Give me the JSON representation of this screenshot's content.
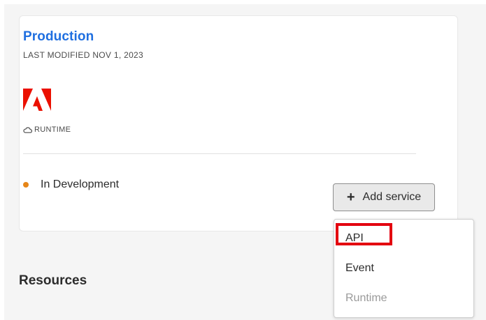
{
  "card": {
    "title": "Production",
    "last_modified": "LAST MODIFIED NOV 1, 2023",
    "logo_icon": "adobe-logo",
    "runtime_label": "RUNTIME",
    "runtime_icon": "cloud-icon",
    "status_text": "In Development",
    "status_color": "#e68619",
    "add_service_label": "Add service",
    "add_service_icon": "plus-icon"
  },
  "menu": {
    "items": [
      {
        "label": "API",
        "enabled": true,
        "highlighted": true
      },
      {
        "label": "Event",
        "enabled": true
      },
      {
        "label": "Runtime",
        "enabled": false
      }
    ]
  },
  "resources_heading": "Resources",
  "colors": {
    "title_blue": "#1f6fe0",
    "adobe_red": "#eb1000",
    "highlight_red": "#e3000f",
    "status_orange": "#e68619"
  }
}
